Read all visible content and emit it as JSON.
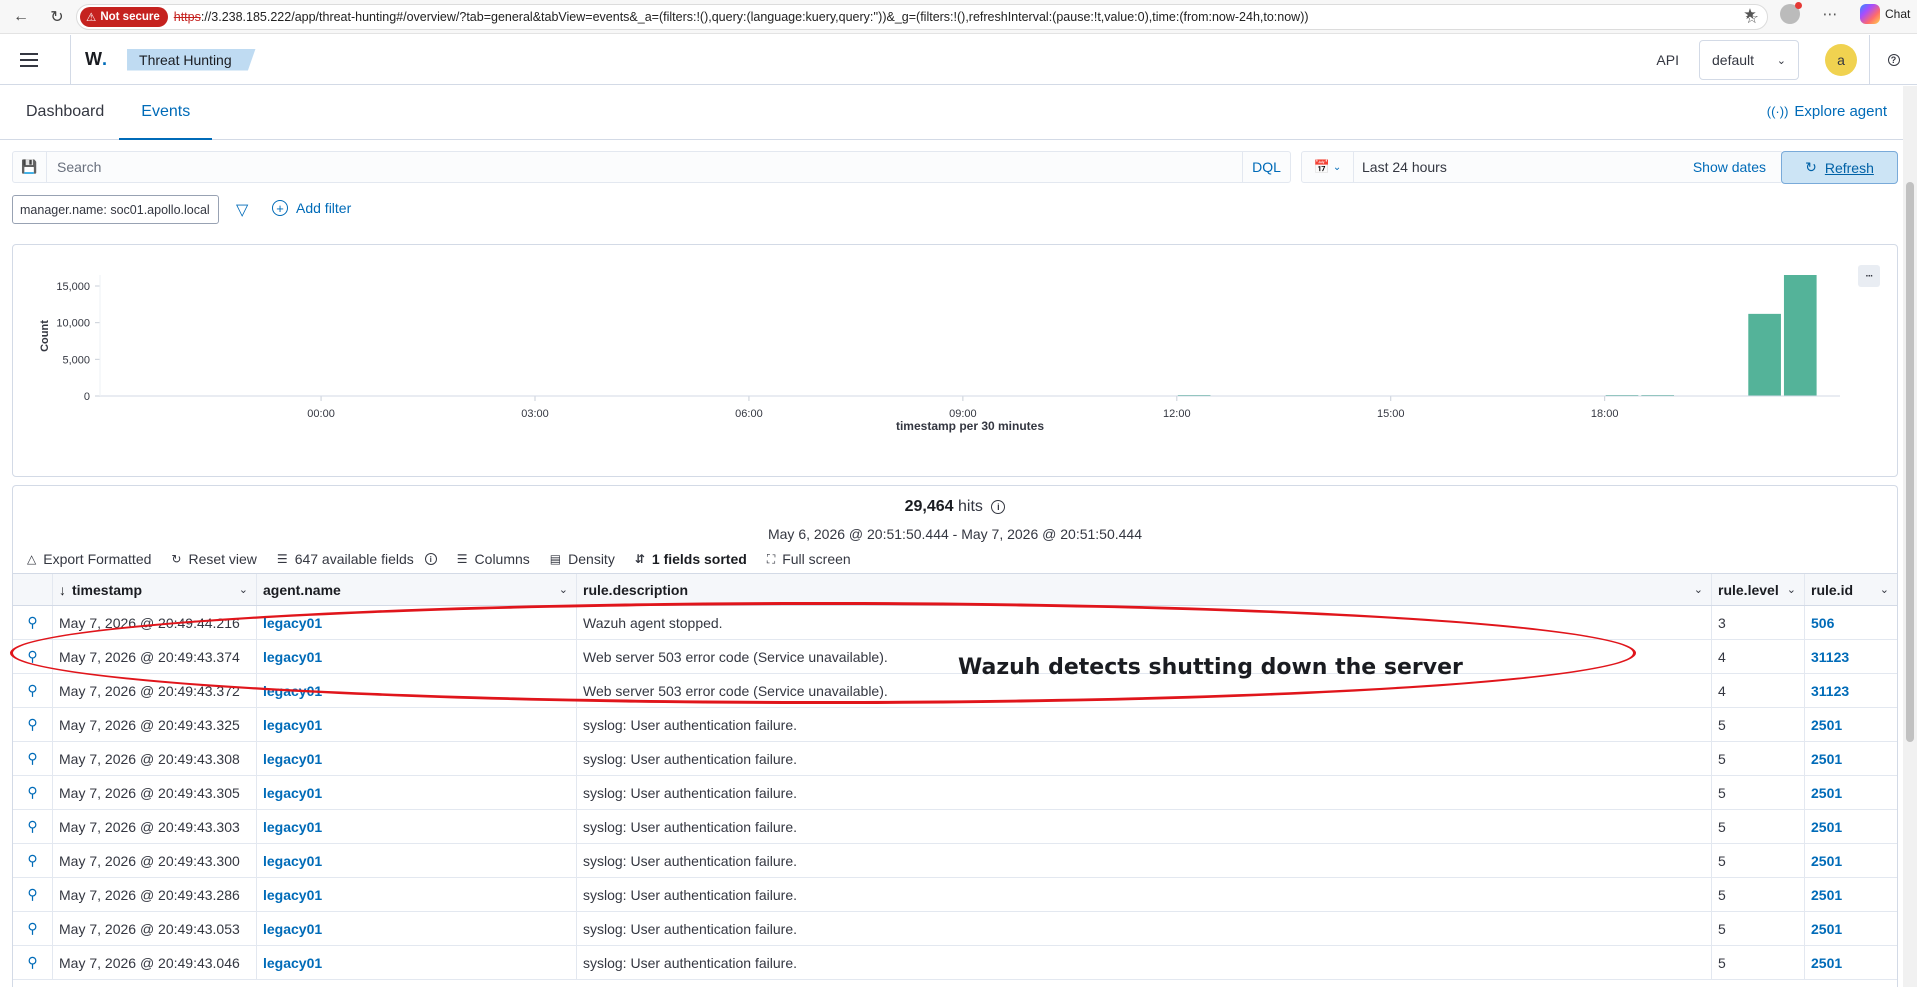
{
  "browser": {
    "not_secure": "Not secure",
    "url_scheme": "https",
    "url_rest": "://3.238.185.222/app/threat-hunting#/overview/?tab=general&tabView=events&_a=(filters:!(),query:(language:kuery,query:''))&_g=(filters:!(),refreshInterval:(pause:!t,value:0),time:(from:now-24h,to:now))",
    "chat_label": "Chat"
  },
  "header": {
    "logo": "W",
    "logo_dot": ".",
    "breadcrumb": "Threat Hunting",
    "api_label": "API",
    "selector_value": "default",
    "user_initial": "a"
  },
  "tabs": [
    {
      "label": "Dashboard"
    },
    {
      "label": "Events"
    }
  ],
  "explore_agent": "Explore agent",
  "query": {
    "placeholder": "Search",
    "language": "DQL",
    "date_range": "Last 24 hours",
    "show_dates": "Show dates",
    "refresh": "Refresh"
  },
  "filters": {
    "pill": "manager.name: soc01.apollo.local",
    "add_filter": "Add filter"
  },
  "chart_data": {
    "type": "bar",
    "ylabel": "Count",
    "xlabel": "timestamp per 30 minutes",
    "ylim": [
      0,
      16500
    ],
    "yticks": [
      0,
      5000,
      10000,
      15000
    ],
    "ytick_labels": [
      "0",
      "5,000",
      "10,000",
      "15,000"
    ],
    "xtick_labels": [
      "00:00",
      "03:00",
      "06:00",
      "09:00",
      "12:00",
      "15:00",
      "18:00"
    ],
    "xtick_hours": [
      0,
      3,
      6,
      9,
      12,
      15,
      18
    ],
    "x_range_hours": [
      -3.1,
      21.3
    ],
    "bar_color": "#54b399",
    "bars": [
      {
        "hour": 12.0,
        "value": 120
      },
      {
        "hour": 18.0,
        "value": 70
      },
      {
        "hour": 18.5,
        "value": 60
      },
      {
        "hour": 20.0,
        "value": 11200
      },
      {
        "hour": 20.5,
        "value": 16500
      }
    ]
  },
  "results": {
    "hits": "29,464",
    "hits_label": "hits",
    "range": "May 6, 2026 @ 20:51:50.444 - May 7, 2026 @ 20:51:50.444",
    "toolbar": {
      "export": "Export Formatted",
      "reset": "Reset view",
      "fields": "647 available fields",
      "columns": "Columns",
      "density": "Density",
      "sorted": "1 fields sorted",
      "fullscreen": "Full screen"
    },
    "columns": [
      "timestamp",
      "agent.name",
      "rule.description",
      "rule.level",
      "rule.id"
    ],
    "rows": [
      {
        "ts": "May 7, 2026 @ 20:49:44.216",
        "agent": "legacy01",
        "desc": "Wazuh agent stopped.",
        "level": "3",
        "id": "506"
      },
      {
        "ts": "May 7, 2026 @ 20:49:43.374",
        "agent": "legacy01",
        "desc": "Web server 503 error code (Service unavailable).",
        "level": "4",
        "id": "31123"
      },
      {
        "ts": "May 7, 2026 @ 20:49:43.372",
        "agent": "legacy01",
        "desc": "Web server 503 error code (Service unavailable).",
        "level": "4",
        "id": "31123"
      },
      {
        "ts": "May 7, 2026 @ 20:49:43.325",
        "agent": "legacy01",
        "desc": "syslog: User authentication failure.",
        "level": "5",
        "id": "2501"
      },
      {
        "ts": "May 7, 2026 @ 20:49:43.308",
        "agent": "legacy01",
        "desc": "syslog: User authentication failure.",
        "level": "5",
        "id": "2501"
      },
      {
        "ts": "May 7, 2026 @ 20:49:43.305",
        "agent": "legacy01",
        "desc": "syslog: User authentication failure.",
        "level": "5",
        "id": "2501"
      },
      {
        "ts": "May 7, 2026 @ 20:49:43.303",
        "agent": "legacy01",
        "desc": "syslog: User authentication failure.",
        "level": "5",
        "id": "2501"
      },
      {
        "ts": "May 7, 2026 @ 20:49:43.300",
        "agent": "legacy01",
        "desc": "syslog: User authentication failure.",
        "level": "5",
        "id": "2501"
      },
      {
        "ts": "May 7, 2026 @ 20:49:43.286",
        "agent": "legacy01",
        "desc": "syslog: User authentication failure.",
        "level": "5",
        "id": "2501"
      },
      {
        "ts": "May 7, 2026 @ 20:49:43.053",
        "agent": "legacy01",
        "desc": "syslog: User authentication failure.",
        "level": "5",
        "id": "2501"
      },
      {
        "ts": "May 7, 2026 @ 20:49:43.046",
        "agent": "legacy01",
        "desc": "syslog: User authentication failure.",
        "level": "5",
        "id": "2501"
      }
    ]
  },
  "annotation": "Wazuh detects shutting down the server"
}
